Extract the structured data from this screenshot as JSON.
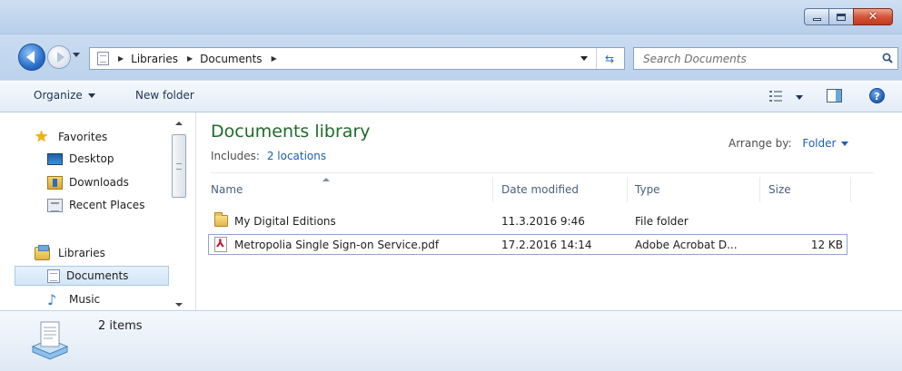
{
  "window": {
    "controls": {
      "minimize": "minimize",
      "maximize": "maximize",
      "close": "close"
    }
  },
  "nav": {
    "breadcrumbs": [
      "Libraries",
      "Documents"
    ],
    "search_placeholder": "Search Documents"
  },
  "toolbar": {
    "organize_label": "Organize",
    "new_folder_label": "New folder",
    "icons": [
      "views-icon",
      "preview-pane-icon",
      "help-icon"
    ]
  },
  "sidebar": {
    "favorites": {
      "label": "Favorites",
      "items": [
        {
          "label": "Desktop",
          "icon": "desktop-icon"
        },
        {
          "label": "Downloads",
          "icon": "downloads-icon"
        },
        {
          "label": "Recent Places",
          "icon": "recent-places-icon"
        }
      ]
    },
    "libraries": {
      "label": "Libraries",
      "items": [
        {
          "label": "Documents",
          "icon": "documents-icon",
          "selected": true
        },
        {
          "label": "Music",
          "icon": "music-icon"
        }
      ]
    }
  },
  "library": {
    "title": "Documents library",
    "includes_label": "Includes:",
    "includes_link": "2 locations",
    "arrange_label": "Arrange by:",
    "arrange_value": "Folder"
  },
  "table": {
    "columns": [
      "Name",
      "Date modified",
      "Type",
      "Size"
    ],
    "rows": [
      {
        "name": "My Digital Editions",
        "date": "11.3.2016 9:46",
        "type": "File folder",
        "size": "",
        "icon": "folder-icon"
      },
      {
        "name": "Metropolia Single Sign-on Service.pdf",
        "date": "17.2.2016 14:14",
        "type": "Adobe Acrobat D...",
        "size": "12 KB",
        "icon": "pdf-icon"
      }
    ]
  },
  "status": {
    "item_count": "2 items"
  },
  "colors": {
    "library_title": "#1e6b2a",
    "link": "#1a5fb4",
    "close_button": "#c2391e"
  }
}
